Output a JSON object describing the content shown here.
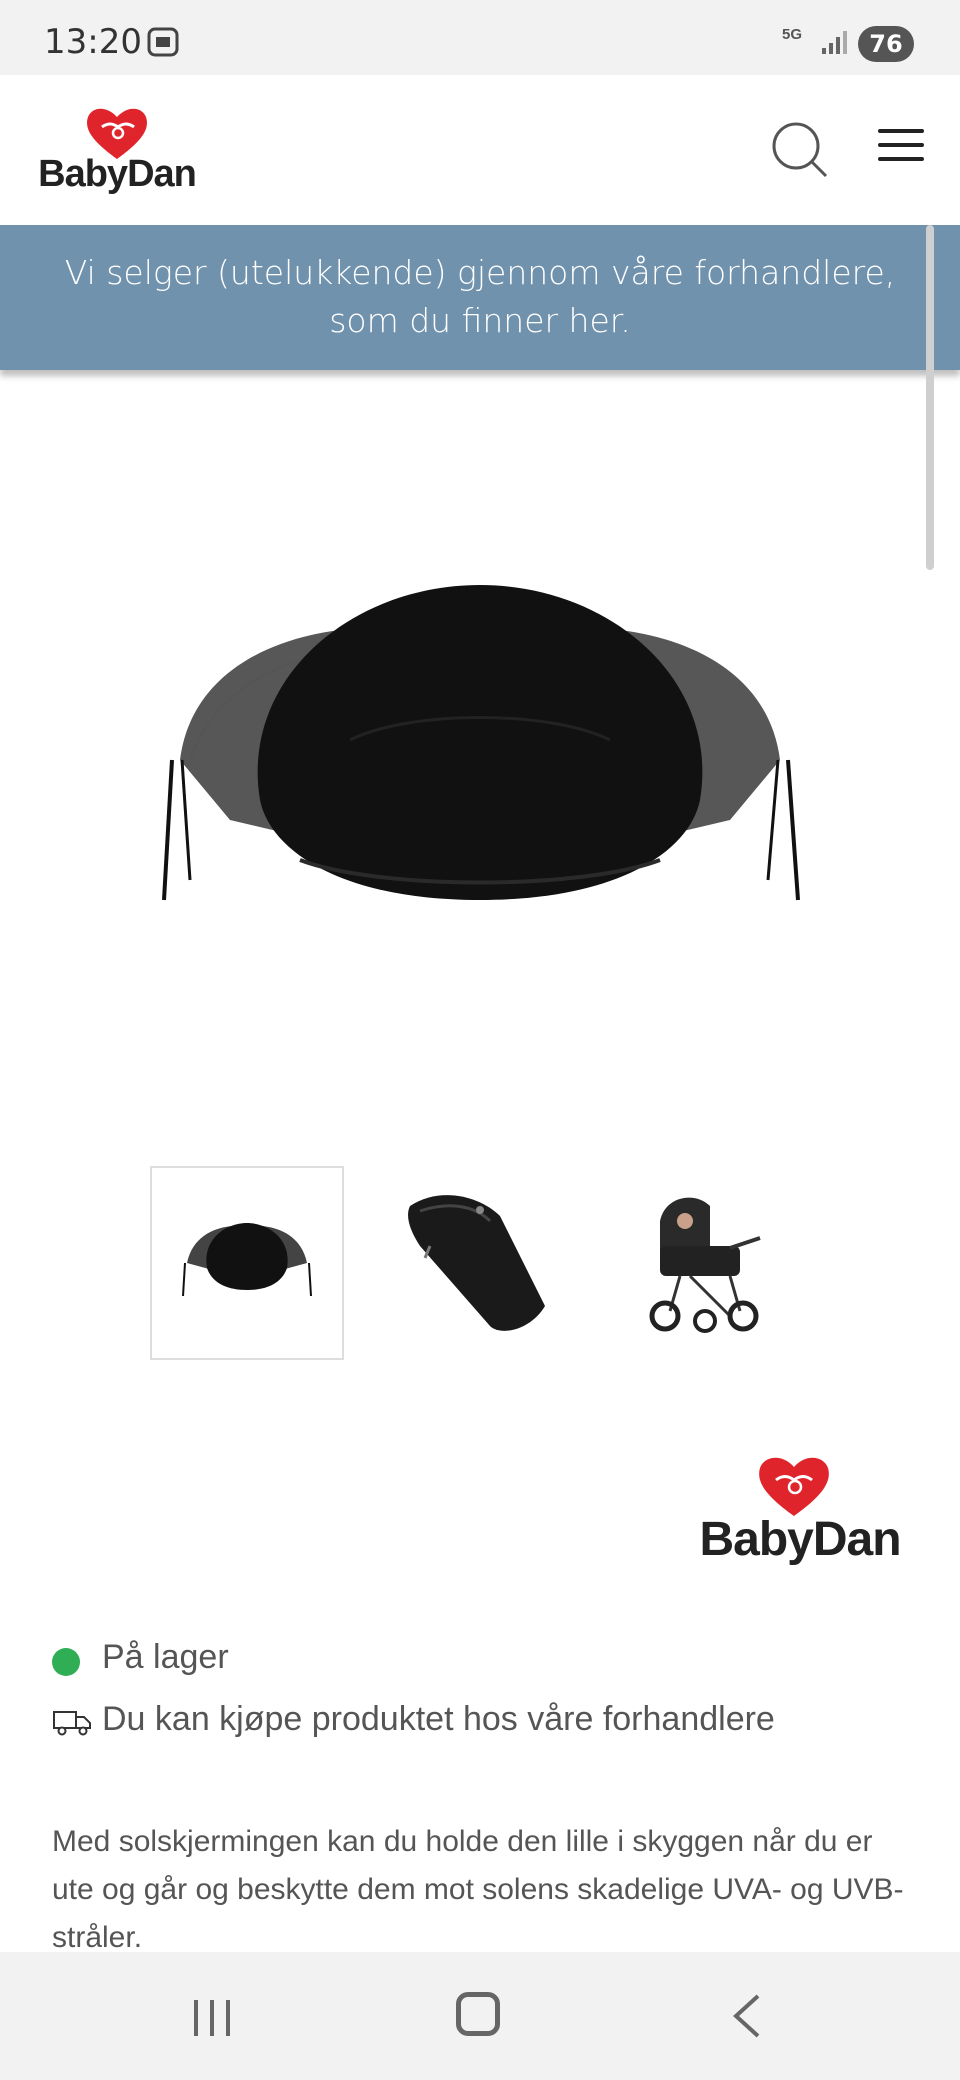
{
  "status_bar": {
    "time": "13:20",
    "network": "5G",
    "battery": "76"
  },
  "header": {
    "logo_text": "BabyDan",
    "search_icon": "search-icon",
    "menu_icon": "hamburger-icon"
  },
  "notice": {
    "text": "Vi selger (utelukkende) gjennom våre forhandlere, som du finner her."
  },
  "gallery": {
    "main_image": "black sun canopy",
    "thumbnails": [
      "sun canopy",
      "folded canopy in pouch",
      "stroller with canopy"
    ],
    "active_index": 0
  },
  "brand": {
    "logo_text": "BabyDan"
  },
  "stock": {
    "label": "På lager",
    "status_color": "#2fae55"
  },
  "retail": {
    "label": "Du kan kjøpe produktet hos våre forhandlere"
  },
  "description": {
    "text": "Med solskjermingen kan du holde den lille i skyggen når du er ute og går og beskytte dem mot solens skadelige UVA- og UVB-stråler."
  },
  "colors": {
    "notice_bg": "#7092ad",
    "heart_red": "#e0242b"
  }
}
